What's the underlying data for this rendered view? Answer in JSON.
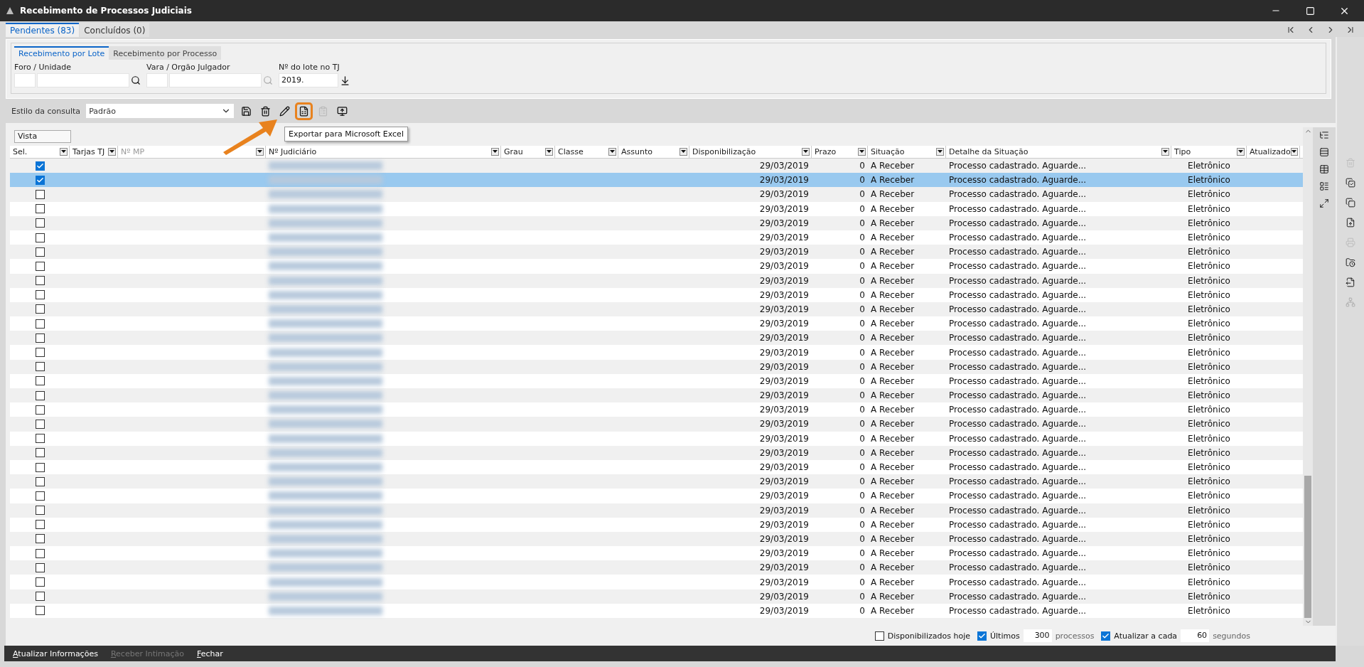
{
  "window": {
    "title": "Recebimento de Processos Judiciais"
  },
  "tabs": [
    {
      "label": "Pendentes (83)",
      "selected": true
    },
    {
      "label": "Concluídos (0)",
      "selected": false
    }
  ],
  "subtabs": [
    {
      "label": "Recebimento por Lote",
      "selected": true
    },
    {
      "label": "Recebimento por Processo",
      "selected": false
    }
  ],
  "filters": [
    {
      "label": "Foro / Unidade",
      "kind": "lookup",
      "disabled": false
    },
    {
      "label": "Vara / Orgão Julgador",
      "kind": "lookup",
      "disabled": true
    },
    {
      "label": "Nº do lote no TJ",
      "kind": "download",
      "value": "2019."
    }
  ],
  "query_style": {
    "label": "Estilo da consulta",
    "value": "Padrão"
  },
  "tooltip": "Exportar para Microsoft Excel",
  "grid": {
    "view": "Vista",
    "columns": [
      {
        "label": "Sel.",
        "disabled": false
      },
      {
        "label": "Tarjas TJ",
        "disabled": false
      },
      {
        "label": "Nº MP",
        "disabled": true
      },
      {
        "label": "Nº Judiciário",
        "disabled": false
      },
      {
        "label": "Grau",
        "disabled": false
      },
      {
        "label": "Classe",
        "disabled": false
      },
      {
        "label": "Assunto",
        "disabled": false
      },
      {
        "label": "Disponibilização",
        "disabled": false
      },
      {
        "label": "Prazo",
        "disabled": false
      },
      {
        "label": "Situação",
        "disabled": false
      },
      {
        "label": "Detalhe da Situação",
        "disabled": false
      },
      {
        "label": "Tipo",
        "disabled": false
      },
      {
        "label": "Atualizado",
        "disabled": false
      }
    ],
    "rows": [
      {
        "checked": true,
        "selected": false,
        "date": "29/03/2019",
        "prazo": "0",
        "situacao": "A Receber",
        "detalhe": "Processo cadastrado. Aguarde...",
        "tipo": "Eletrônico"
      },
      {
        "checked": true,
        "selected": true,
        "date": "29/03/2019",
        "prazo": "0",
        "situacao": "A Receber",
        "detalhe": "Processo cadastrado. Aguarde...",
        "tipo": "Eletrônico"
      },
      {
        "checked": false,
        "selected": false,
        "date": "29/03/2019",
        "prazo": "0",
        "situacao": "A Receber",
        "detalhe": "Processo cadastrado. Aguarde...",
        "tipo": "Eletrônico"
      },
      {
        "checked": false,
        "selected": false,
        "date": "29/03/2019",
        "prazo": "0",
        "situacao": "A Receber",
        "detalhe": "Processo cadastrado. Aguarde...",
        "tipo": "Eletrônico"
      },
      {
        "checked": false,
        "selected": false,
        "date": "29/03/2019",
        "prazo": "0",
        "situacao": "A Receber",
        "detalhe": "Processo cadastrado. Aguarde...",
        "tipo": "Eletrônico"
      },
      {
        "checked": false,
        "selected": false,
        "date": "29/03/2019",
        "prazo": "0",
        "situacao": "A Receber",
        "detalhe": "Processo cadastrado. Aguarde...",
        "tipo": "Eletrônico"
      },
      {
        "checked": false,
        "selected": false,
        "date": "29/03/2019",
        "prazo": "0",
        "situacao": "A Receber",
        "detalhe": "Processo cadastrado. Aguarde...",
        "tipo": "Eletrônico"
      },
      {
        "checked": false,
        "selected": false,
        "date": "29/03/2019",
        "prazo": "0",
        "situacao": "A Receber",
        "detalhe": "Processo cadastrado. Aguarde...",
        "tipo": "Eletrônico"
      },
      {
        "checked": false,
        "selected": false,
        "date": "29/03/2019",
        "prazo": "0",
        "situacao": "A Receber",
        "detalhe": "Processo cadastrado. Aguarde...",
        "tipo": "Eletrônico"
      },
      {
        "checked": false,
        "selected": false,
        "date": "29/03/2019",
        "prazo": "0",
        "situacao": "A Receber",
        "detalhe": "Processo cadastrado. Aguarde...",
        "tipo": "Eletrônico"
      },
      {
        "checked": false,
        "selected": false,
        "date": "29/03/2019",
        "prazo": "0",
        "situacao": "A Receber",
        "detalhe": "Processo cadastrado. Aguarde...",
        "tipo": "Eletrônico"
      },
      {
        "checked": false,
        "selected": false,
        "date": "29/03/2019",
        "prazo": "0",
        "situacao": "A Receber",
        "detalhe": "Processo cadastrado. Aguarde...",
        "tipo": "Eletrônico"
      },
      {
        "checked": false,
        "selected": false,
        "date": "29/03/2019",
        "prazo": "0",
        "situacao": "A Receber",
        "detalhe": "Processo cadastrado. Aguarde...",
        "tipo": "Eletrônico"
      },
      {
        "checked": false,
        "selected": false,
        "date": "29/03/2019",
        "prazo": "0",
        "situacao": "A Receber",
        "detalhe": "Processo cadastrado. Aguarde...",
        "tipo": "Eletrônico"
      },
      {
        "checked": false,
        "selected": false,
        "date": "29/03/2019",
        "prazo": "0",
        "situacao": "A Receber",
        "detalhe": "Processo cadastrado. Aguarde...",
        "tipo": "Eletrônico"
      },
      {
        "checked": false,
        "selected": false,
        "date": "29/03/2019",
        "prazo": "0",
        "situacao": "A Receber",
        "detalhe": "Processo cadastrado. Aguarde...",
        "tipo": "Eletrônico"
      },
      {
        "checked": false,
        "selected": false,
        "date": "29/03/2019",
        "prazo": "0",
        "situacao": "A Receber",
        "detalhe": "Processo cadastrado. Aguarde...",
        "tipo": "Eletrônico"
      },
      {
        "checked": false,
        "selected": false,
        "date": "29/03/2019",
        "prazo": "0",
        "situacao": "A Receber",
        "detalhe": "Processo cadastrado. Aguarde...",
        "tipo": "Eletrônico"
      },
      {
        "checked": false,
        "selected": false,
        "date": "29/03/2019",
        "prazo": "0",
        "situacao": "A Receber",
        "detalhe": "Processo cadastrado. Aguarde...",
        "tipo": "Eletrônico"
      },
      {
        "checked": false,
        "selected": false,
        "date": "29/03/2019",
        "prazo": "0",
        "situacao": "A Receber",
        "detalhe": "Processo cadastrado. Aguarde...",
        "tipo": "Eletrônico"
      },
      {
        "checked": false,
        "selected": false,
        "date": "29/03/2019",
        "prazo": "0",
        "situacao": "A Receber",
        "detalhe": "Processo cadastrado. Aguarde...",
        "tipo": "Eletrônico"
      },
      {
        "checked": false,
        "selected": false,
        "date": "29/03/2019",
        "prazo": "0",
        "situacao": "A Receber",
        "detalhe": "Processo cadastrado. Aguarde...",
        "tipo": "Eletrônico"
      },
      {
        "checked": false,
        "selected": false,
        "date": "29/03/2019",
        "prazo": "0",
        "situacao": "A Receber",
        "detalhe": "Processo cadastrado. Aguarde...",
        "tipo": "Eletrônico"
      },
      {
        "checked": false,
        "selected": false,
        "date": "29/03/2019",
        "prazo": "0",
        "situacao": "A Receber",
        "detalhe": "Processo cadastrado. Aguarde...",
        "tipo": "Eletrônico"
      },
      {
        "checked": false,
        "selected": false,
        "date": "29/03/2019",
        "prazo": "0",
        "situacao": "A Receber",
        "detalhe": "Processo cadastrado. Aguarde...",
        "tipo": "Eletrônico"
      },
      {
        "checked": false,
        "selected": false,
        "date": "29/03/2019",
        "prazo": "0",
        "situacao": "A Receber",
        "detalhe": "Processo cadastrado. Aguarde...",
        "tipo": "Eletrônico"
      },
      {
        "checked": false,
        "selected": false,
        "date": "29/03/2019",
        "prazo": "0",
        "situacao": "A Receber",
        "detalhe": "Processo cadastrado. Aguarde...",
        "tipo": "Eletrônico"
      },
      {
        "checked": false,
        "selected": false,
        "date": "29/03/2019",
        "prazo": "0",
        "situacao": "A Receber",
        "detalhe": "Processo cadastrado. Aguarde...",
        "tipo": "Eletrônico"
      },
      {
        "checked": false,
        "selected": false,
        "date": "29/03/2019",
        "prazo": "0",
        "situacao": "A Receber",
        "detalhe": "Processo cadastrado. Aguarde...",
        "tipo": "Eletrônico"
      },
      {
        "checked": false,
        "selected": false,
        "date": "29/03/2019",
        "prazo": "0",
        "situacao": "A Receber",
        "detalhe": "Processo cadastrado. Aguarde...",
        "tipo": "Eletrônico"
      },
      {
        "checked": false,
        "selected": false,
        "date": "29/03/2019",
        "prazo": "0",
        "situacao": "A Receber",
        "detalhe": "Processo cadastrado. Aguarde...",
        "tipo": "Eletrônico"
      },
      {
        "checked": false,
        "selected": false,
        "date": "29/03/2019",
        "prazo": "0",
        "situacao": "A Receber",
        "detalhe": "Processo cadastrado. Aguarde...",
        "tipo": "Eletrônico"
      }
    ]
  },
  "options": [
    {
      "label": "Disponibilizados hoje",
      "checked": false
    },
    {
      "label": "Últimos",
      "checked": true,
      "value": "300",
      "unit": "processos"
    },
    {
      "label": "Atualizar a cada",
      "checked": true,
      "value": "60",
      "unit": "segundos"
    }
  ],
  "actions": [
    {
      "label": "Atualizar Informações",
      "disabled": false
    },
    {
      "label": "Receber Intimação",
      "disabled": true
    },
    {
      "label": "Fechar",
      "disabled": false
    }
  ]
}
